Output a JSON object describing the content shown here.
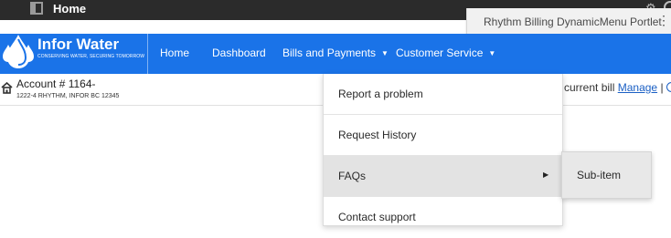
{
  "topbar": {
    "title": "Home",
    "settings_icon": "gear-icon",
    "help_icon": "globe-icon"
  },
  "portlet": {
    "label": "Rhythm Billing DynamicMenu Portlet",
    "menu_icon": "kebab-icon"
  },
  "brand": {
    "name": "Infor Water",
    "tagline": "CONSERVING WATER, SECURING TOMORROW",
    "color": "#1a73e8"
  },
  "nav": {
    "items": [
      {
        "label": "Home"
      },
      {
        "label": "Dashboard"
      },
      {
        "label": "Bills and Payments",
        "caret": "▼"
      },
      {
        "label": "Customer Service",
        "caret": "▼"
      }
    ]
  },
  "account": {
    "title": "Account # 1164-",
    "address": "1222-4 RHYTHM, INFOR BC 12345",
    "bill_text": "e current bill",
    "manage_label": "Manage",
    "separator": "|"
  },
  "dropdown": {
    "items": [
      {
        "label": "Report a problem"
      },
      {
        "label": "Request History"
      },
      {
        "label": "FAQs",
        "arrow": "▶"
      },
      {
        "label": "Contact support"
      }
    ]
  },
  "submenu": {
    "items": [
      {
        "label": "Sub-item"
      }
    ]
  }
}
